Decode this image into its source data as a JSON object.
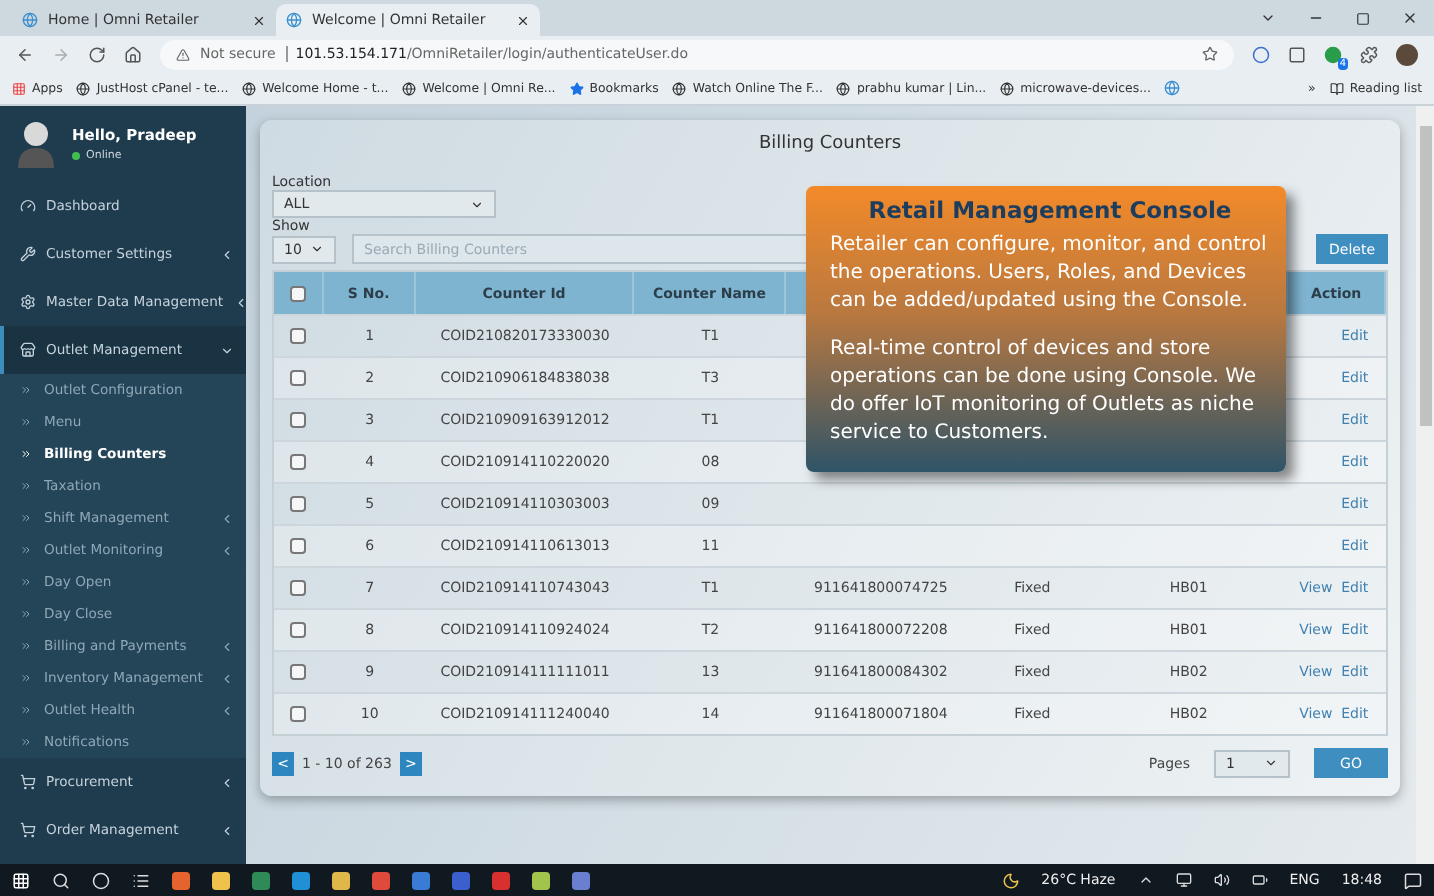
{
  "browser": {
    "tabs": [
      {
        "title": "Home | Omni Retailer",
        "selected": false
      },
      {
        "title": "Welcome | Omni Retailer",
        "selected": true
      }
    ],
    "security": "Not secure",
    "url_host": "101.53.154.171",
    "url_path": "/OmniRetailer/login/authenticateUser.do",
    "extension_badge": "4",
    "bookmarks": [
      "Apps",
      "JustHost cPanel - te...",
      "Welcome Home - t...",
      "Welcome | Omni Re...",
      "Bookmarks",
      "Watch Online The F...",
      "prabhu kumar | Lin...",
      "microwave-devices..."
    ],
    "overflow": "»",
    "reading_list": "Reading list"
  },
  "user": {
    "greeting": "Hello, Pradeep",
    "status": "Online"
  },
  "sidebar": {
    "items": [
      {
        "label": "Dashboard",
        "kind": "link"
      },
      {
        "label": "Customer Settings",
        "kind": "menu",
        "expanded": false
      },
      {
        "label": "Master Data Management",
        "kind": "menu",
        "expanded": false
      },
      {
        "label": "Outlet Management",
        "kind": "menu",
        "expanded": true,
        "children": [
          {
            "label": "Outlet Configuration",
            "selected": false
          },
          {
            "label": "Menu",
            "selected": false
          },
          {
            "label": "Billing Counters",
            "selected": true
          },
          {
            "label": "Taxation",
            "selected": false
          },
          {
            "label": "Shift Management",
            "selected": false,
            "submenu": true
          },
          {
            "label": "Outlet Monitoring",
            "selected": false,
            "submenu": true
          },
          {
            "label": "Day Open",
            "selected": false
          },
          {
            "label": "Day Close",
            "selected": false
          },
          {
            "label": "Billing and Payments",
            "selected": false,
            "submenu": true
          },
          {
            "label": "Inventory Management",
            "selected": false,
            "submenu": true
          },
          {
            "label": "Outlet Health",
            "selected": false,
            "submenu": true
          },
          {
            "label": "Notifications",
            "selected": false
          }
        ]
      },
      {
        "label": "Procurement",
        "kind": "menu",
        "expanded": false
      },
      {
        "label": "Order Management",
        "kind": "menu",
        "expanded": false
      }
    ]
  },
  "main": {
    "title": "Billing Counters",
    "location_label": "Location",
    "location_value": "ALL",
    "show_label": "Show",
    "show_value": "10",
    "search": {
      "placeholder": "Search Billing Counters"
    },
    "delete_button": "Delete",
    "table": {
      "select_all_checked": false,
      "columns": [
        {
          "label": "S No."
        },
        {
          "label": "Counter Id"
        },
        {
          "label": "Counter Name"
        },
        {
          "label": "Action"
        }
      ],
      "rows": [
        {
          "checked": false,
          "s_no": "1",
          "counter_id": "COID210820173330030",
          "counter_name": "T1",
          "edit": "Edit"
        },
        {
          "checked": false,
          "s_no": "2",
          "counter_id": "COID210906184838038",
          "counter_name": "T3",
          "edit": "Edit"
        },
        {
          "checked": false,
          "s_no": "3",
          "counter_id": "COID210909163912012",
          "counter_name": "T1",
          "edit": "Edit"
        },
        {
          "checked": false,
          "s_no": "4",
          "counter_id": "COID210914110220020",
          "counter_name": "08",
          "edit": "Edit"
        },
        {
          "checked": false,
          "s_no": "5",
          "counter_id": "COID210914110303003",
          "counter_name": "09",
          "edit": "Edit"
        },
        {
          "checked": false,
          "s_no": "6",
          "counter_id": "COID210914110613013",
          "counter_name": "11",
          "edit": "Edit"
        },
        {
          "checked": false,
          "s_no": "7",
          "counter_id": "COID210914110743043",
          "counter_name": "T1",
          "column_5": "911641800074725",
          "column_6": "Fixed",
          "column_7": "HB01",
          "view": "View",
          "edit": "Edit"
        },
        {
          "checked": false,
          "s_no": "8",
          "counter_id": "COID210914110924024",
          "counter_name": "T2",
          "column_5": "911641800072208",
          "column_6": "Fixed",
          "column_7": "HB01",
          "view": "View",
          "edit": "Edit"
        },
        {
          "checked": false,
          "s_no": "9",
          "counter_id": "COID210914111111011",
          "counter_name": "13",
          "column_5": "911641800084302",
          "column_6": "Fixed",
          "column_7": "HB02",
          "view": "View",
          "edit": "Edit"
        },
        {
          "checked": false,
          "s_no": "10",
          "counter_id": "COID210914111240040",
          "counter_name": "14",
          "column_5": "911641800071804",
          "column_6": "Fixed",
          "column_7": "HB02",
          "view": "View",
          "edit": "Edit"
        }
      ]
    },
    "pagination": {
      "prev": "<",
      "range": "1 - 10 of 263",
      "next": ">",
      "pages_label": "Pages",
      "page_value": "1",
      "go": "GO"
    }
  },
  "overlay": {
    "title": "Retail Management Console",
    "paragraphs": [
      "Retailer can configure, monitor, and control the operations. Users, Roles, and Devices can be added/updated using the Console.",
      "Real-time control of devices and store operations can be done using Console. We do offer IoT monitoring of Outlets as niche service to Customers."
    ]
  },
  "taskbar": {
    "weather": "26°C Haze",
    "language": "ENG",
    "time": "18:48"
  }
}
